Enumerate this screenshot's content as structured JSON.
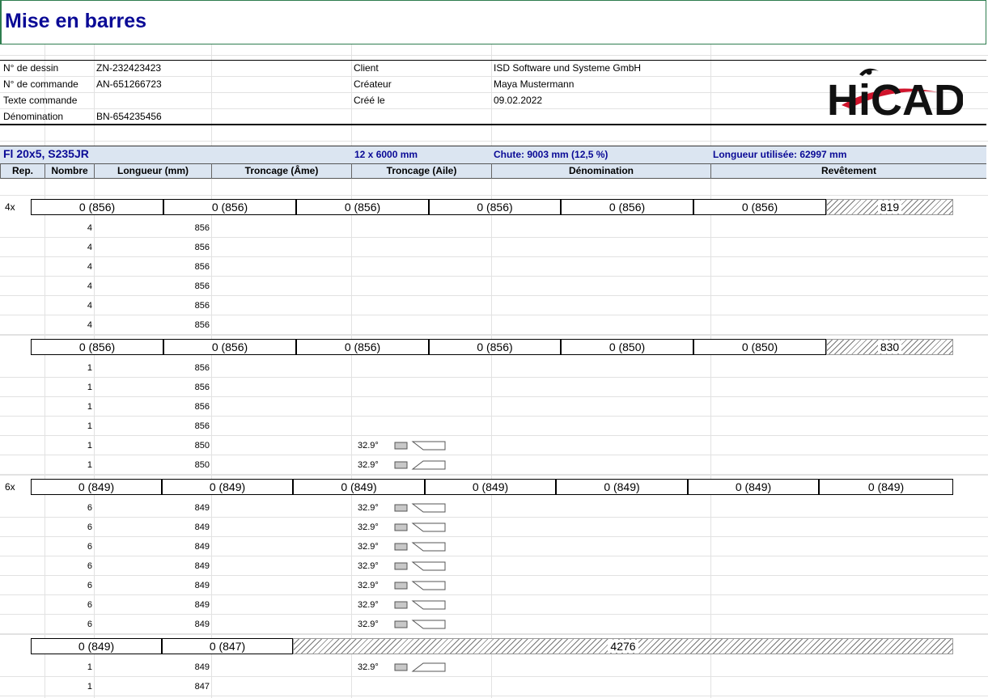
{
  "title": "Mise en barres",
  "info": {
    "left": [
      {
        "label": "N° de dessin",
        "value": "ZN-232423423"
      },
      {
        "label": "N° de commande",
        "value": "AN-651266723"
      },
      {
        "label": "Texte commande",
        "value": ""
      },
      {
        "label": "Dénomination",
        "value": "BN-654235456"
      }
    ],
    "right": [
      {
        "label": "Client",
        "value": "ISD Software und Systeme GmbH"
      },
      {
        "label": "Créateur",
        "value": "Maya Mustermann"
      },
      {
        "label": "Créé le",
        "value": "09.02.2022"
      }
    ],
    "logo": "HiCAD"
  },
  "section": {
    "profile": "Fl 20x5, S235JR",
    "stock": "12 x 6000 mm",
    "waste": "Chute: 9003 mm (12,5 %)",
    "used": "Longueur utilisée: 62997 mm"
  },
  "columns": [
    "Rep.",
    "Nombre",
    "Longueur (mm)",
    "Troncage (Âme)",
    "Troncage (Aile)",
    "Dénomination",
    "Revêtement"
  ],
  "groups": [
    {
      "rep": "4x",
      "bars": [
        "0 (856)",
        "0 (856)",
        "0 (856)",
        "0 (856)",
        "0 (856)",
        "0 (856)"
      ],
      "rest": "819",
      "rows": [
        {
          "count": "4",
          "length": "856",
          "angle": ""
        },
        {
          "count": "4",
          "length": "856",
          "angle": ""
        },
        {
          "count": "4",
          "length": "856",
          "angle": ""
        },
        {
          "count": "4",
          "length": "856",
          "angle": ""
        },
        {
          "count": "4",
          "length": "856",
          "angle": ""
        },
        {
          "count": "4",
          "length": "856",
          "angle": ""
        }
      ]
    },
    {
      "rep": "",
      "bars": [
        "0 (856)",
        "0 (856)",
        "0 (856)",
        "0 (856)",
        "0 (850)",
        "0 (850)"
      ],
      "rest": "830",
      "rows": [
        {
          "count": "1",
          "length": "856",
          "angle": ""
        },
        {
          "count": "1",
          "length": "856",
          "angle": ""
        },
        {
          "count": "1",
          "length": "856",
          "angle": ""
        },
        {
          "count": "1",
          "length": "856",
          "angle": ""
        },
        {
          "count": "1",
          "length": "850",
          "angle": "32.9°",
          "dir": "a"
        },
        {
          "count": "1",
          "length": "850",
          "angle": "32.9°",
          "dir": "b"
        }
      ]
    },
    {
      "rep": "6x",
      "bars": [
        "0 (849)",
        "0 (849)",
        "0 (849)",
        "0 (849)",
        "0 (849)",
        "0 (849)",
        "0 (849)"
      ],
      "rest": "",
      "rows": [
        {
          "count": "6",
          "length": "849",
          "angle": "32.9°",
          "dir": "a"
        },
        {
          "count": "6",
          "length": "849",
          "angle": "32.9°",
          "dir": "a"
        },
        {
          "count": "6",
          "length": "849",
          "angle": "32.9°",
          "dir": "a"
        },
        {
          "count": "6",
          "length": "849",
          "angle": "32.9°",
          "dir": "a"
        },
        {
          "count": "6",
          "length": "849",
          "angle": "32.9°",
          "dir": "a"
        },
        {
          "count": "6",
          "length": "849",
          "angle": "32.9°",
          "dir": "a"
        },
        {
          "count": "6",
          "length": "849",
          "angle": "32.9°",
          "dir": "a"
        }
      ]
    },
    {
      "rep": "",
      "bars": [
        "0 (849)",
        "0 (847)"
      ],
      "rest": "4276",
      "rows": [
        {
          "count": "1",
          "length": "849",
          "angle": "32.9°",
          "dir": "b"
        },
        {
          "count": "1",
          "length": "847",
          "angle": ""
        }
      ]
    }
  ]
}
